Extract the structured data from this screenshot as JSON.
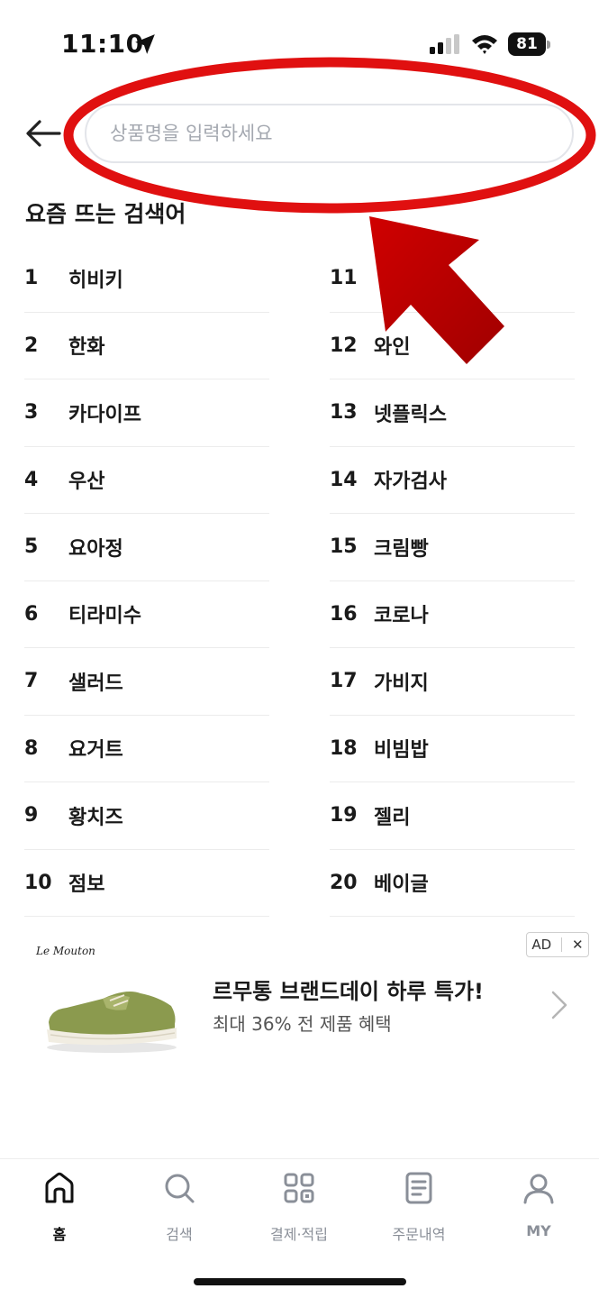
{
  "status_bar": {
    "time": "11:10",
    "battery": "81"
  },
  "search": {
    "placeholder": "상품명을 입력하세요"
  },
  "trending": {
    "title": "요즘 뜨는 검색어",
    "left": [
      {
        "rank": "1",
        "word": "히비키"
      },
      {
        "rank": "2",
        "word": "한화"
      },
      {
        "rank": "3",
        "word": "카다이프"
      },
      {
        "rank": "4",
        "word": "우산"
      },
      {
        "rank": "5",
        "word": "요아정"
      },
      {
        "rank": "6",
        "word": "티라미수"
      },
      {
        "rank": "7",
        "word": "샐러드"
      },
      {
        "rank": "8",
        "word": "요거트"
      },
      {
        "rank": "9",
        "word": "황치즈"
      },
      {
        "rank": "10",
        "word": "점보"
      }
    ],
    "right": [
      {
        "rank": "11",
        "word": ""
      },
      {
        "rank": "12",
        "word": "와인"
      },
      {
        "rank": "13",
        "word": "넷플릭스"
      },
      {
        "rank": "14",
        "word": "자가검사"
      },
      {
        "rank": "15",
        "word": "크림빵"
      },
      {
        "rank": "16",
        "word": "코로나"
      },
      {
        "rank": "17",
        "word": "가비지"
      },
      {
        "rank": "18",
        "word": "비빔밥"
      },
      {
        "rank": "19",
        "word": "젤리"
      },
      {
        "rank": "20",
        "word": "베이글"
      }
    ]
  },
  "ad": {
    "badge": "AD",
    "close": "✕",
    "brand_logo": "Le Mouton",
    "title": "르무통 브랜드데이 하루 특가!",
    "subtitle": "최대 36% 전 제품 혜택"
  },
  "bottom_nav": {
    "items": [
      {
        "label": "홈",
        "icon": "home-icon",
        "active": true
      },
      {
        "label": "검색",
        "icon": "search-icon",
        "active": false
      },
      {
        "label": "결제·적립",
        "icon": "grid-icon",
        "active": false
      },
      {
        "label": "주문내역",
        "icon": "document-icon",
        "active": false
      },
      {
        "label": "MY",
        "icon": "user-icon",
        "active": false
      }
    ]
  },
  "colors": {
    "annotation_red": "#e01010",
    "text": "#1a1a1a",
    "muted": "#8a8f98"
  }
}
